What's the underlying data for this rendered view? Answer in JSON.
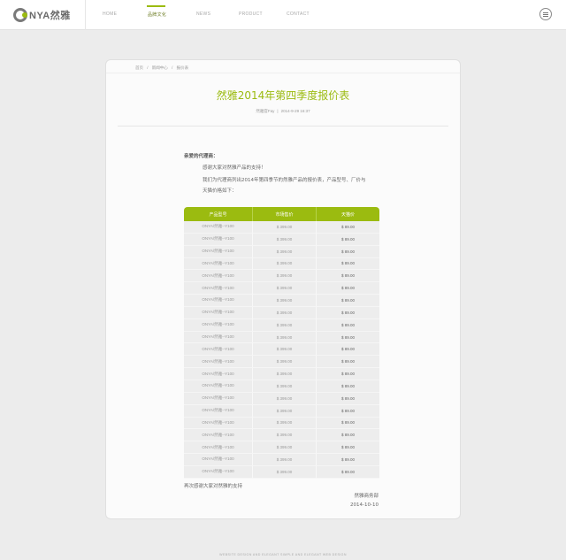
{
  "header": {
    "logo_text": "NYA然雅",
    "nav": [
      {
        "label": "HOME"
      },
      {
        "label": "品牌文化"
      },
      {
        "label": "NEWS"
      },
      {
        "label": "PRODUCT"
      },
      {
        "label": "CONTACT"
      }
    ],
    "active_nav": "品牌文化"
  },
  "breadcrumb": [
    "首页",
    "/",
    "新闻中心",
    "/",
    "报价表"
  ],
  "article": {
    "title": "然雅2014年第四季度报价表",
    "author": "然雅官Fay",
    "meta_sep": "|",
    "date": "2014-9-29 16:37",
    "greeting": "亲爱的代理商：",
    "para1": "感谢大家对然雅产品的支持！",
    "para2": "我们为代理商列出2014年第四季节的然雅产品的报价表，产品型号、厂价与",
    "para3": "天猫价格如下：",
    "table": {
      "headers": [
        "产品型号",
        "市场售价",
        "天猫价"
      ],
      "rows": [
        [
          "ONYA/然雅--Y100",
          "$ 399.00",
          "$ 89.00"
        ],
        [
          "ONYA/然雅--Y100",
          "$ 399.00",
          "$ 89.00"
        ],
        [
          "ONYA/然雅--Y100",
          "$ 399.00",
          "$ 89.00"
        ],
        [
          "ONYA/然雅--Y100",
          "$ 399.00",
          "$ 89.00"
        ],
        [
          "ONYA/然雅--Y100",
          "$ 399.00",
          "$ 89.00"
        ],
        [
          "ONYA/然雅--Y100",
          "$ 399.00",
          "$ 89.00"
        ],
        [
          "ONYA/然雅--Y100",
          "$ 399.00",
          "$ 89.00"
        ],
        [
          "ONYA/然雅--Y100",
          "$ 399.00",
          "$ 89.00"
        ],
        [
          "ONYA/然雅--Y100",
          "$ 399.00",
          "$ 89.00"
        ],
        [
          "ONYA/然雅--Y100",
          "$ 399.00",
          "$ 89.00"
        ],
        [
          "ONYA/然雅--Y100",
          "$ 399.00",
          "$ 89.00"
        ],
        [
          "ONYA/然雅--Y100",
          "$ 399.00",
          "$ 89.00"
        ],
        [
          "ONYA/然雅--Y100",
          "$ 399.00",
          "$ 89.00"
        ],
        [
          "ONYA/然雅--Y100",
          "$ 399.00",
          "$ 89.00"
        ],
        [
          "ONYA/然雅--Y100",
          "$ 399.00",
          "$ 89.00"
        ],
        [
          "ONYA/然雅--Y100",
          "$ 399.00",
          "$ 89.00"
        ],
        [
          "ONYA/然雅--Y100",
          "$ 399.00",
          "$ 89.00"
        ],
        [
          "ONYA/然雅--Y100",
          "$ 399.00",
          "$ 89.00"
        ],
        [
          "ONYA/然雅--Y100",
          "$ 399.00",
          "$ 89.00"
        ],
        [
          "ONYA/然雅--Y100",
          "$ 399.00",
          "$ 89.00"
        ],
        [
          "ONYA/然雅--Y100",
          "$ 399.00",
          "$ 89.00"
        ]
      ]
    },
    "thanks": "再次感谢大家对然雅的支持",
    "signer": "然雅商务部",
    "sign_date": "2014-10-10"
  },
  "footer": {
    "text": "WEBSITE DESIGN AND ELEGANT SIMPLE AND ELEGANT WEB DESIGN"
  },
  "colors": {
    "accent": "#9bbb10",
    "background": "#ececec",
    "card": "#fbfbfb",
    "table_cell": "#ededed"
  },
  "icons": [
    "logo-mark-icon",
    "hamburger-menu-icon"
  ]
}
